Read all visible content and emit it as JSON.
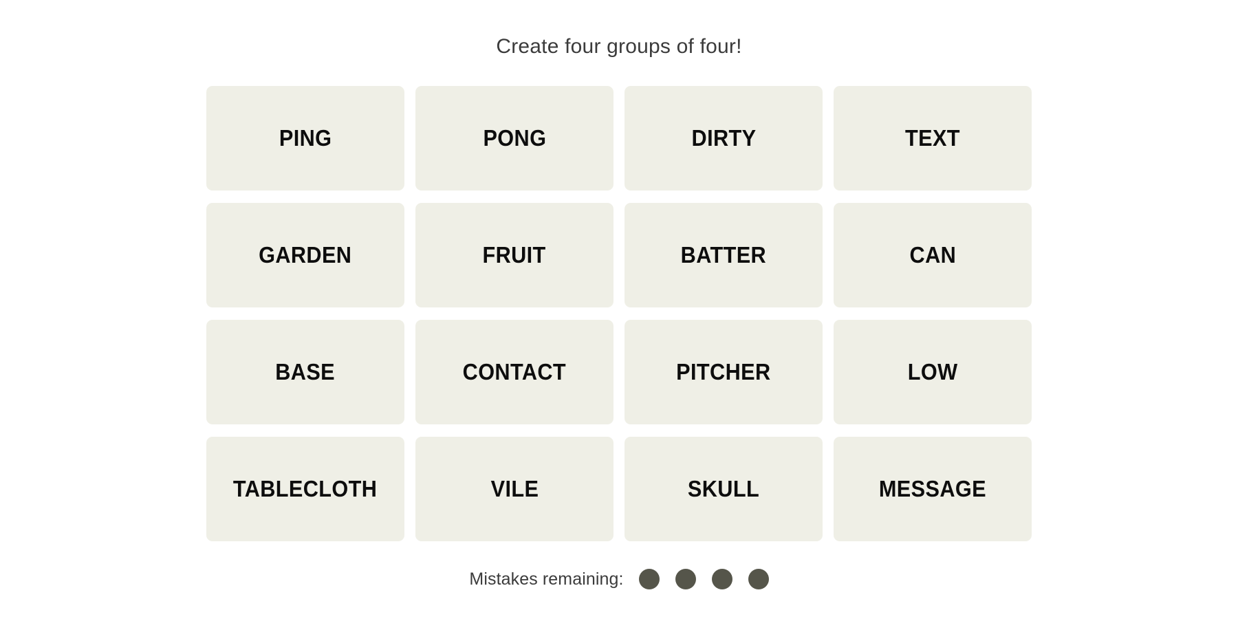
{
  "board": {
    "title": "Create four groups of four!",
    "tiles": [
      {
        "label": "PING"
      },
      {
        "label": "PONG"
      },
      {
        "label": "DIRTY"
      },
      {
        "label": "TEXT"
      },
      {
        "label": "GARDEN"
      },
      {
        "label": "FRUIT"
      },
      {
        "label": "BATTER"
      },
      {
        "label": "CAN"
      },
      {
        "label": "BASE"
      },
      {
        "label": "CONTACT"
      },
      {
        "label": "PITCHER"
      },
      {
        "label": "LOW"
      },
      {
        "label": "TABLECLOTH"
      },
      {
        "label": "VILE"
      },
      {
        "label": "SKULL"
      },
      {
        "label": "MESSAGE"
      }
    ]
  },
  "footer": {
    "mistakes_label": "Mistakes remaining:",
    "mistakes_remaining": 4
  },
  "colors": {
    "background": "#ffffff",
    "tile": "#efefe6",
    "tile_text": "#0d0d0d",
    "title_text": "#3b3b3b",
    "dot": "#55554a"
  }
}
